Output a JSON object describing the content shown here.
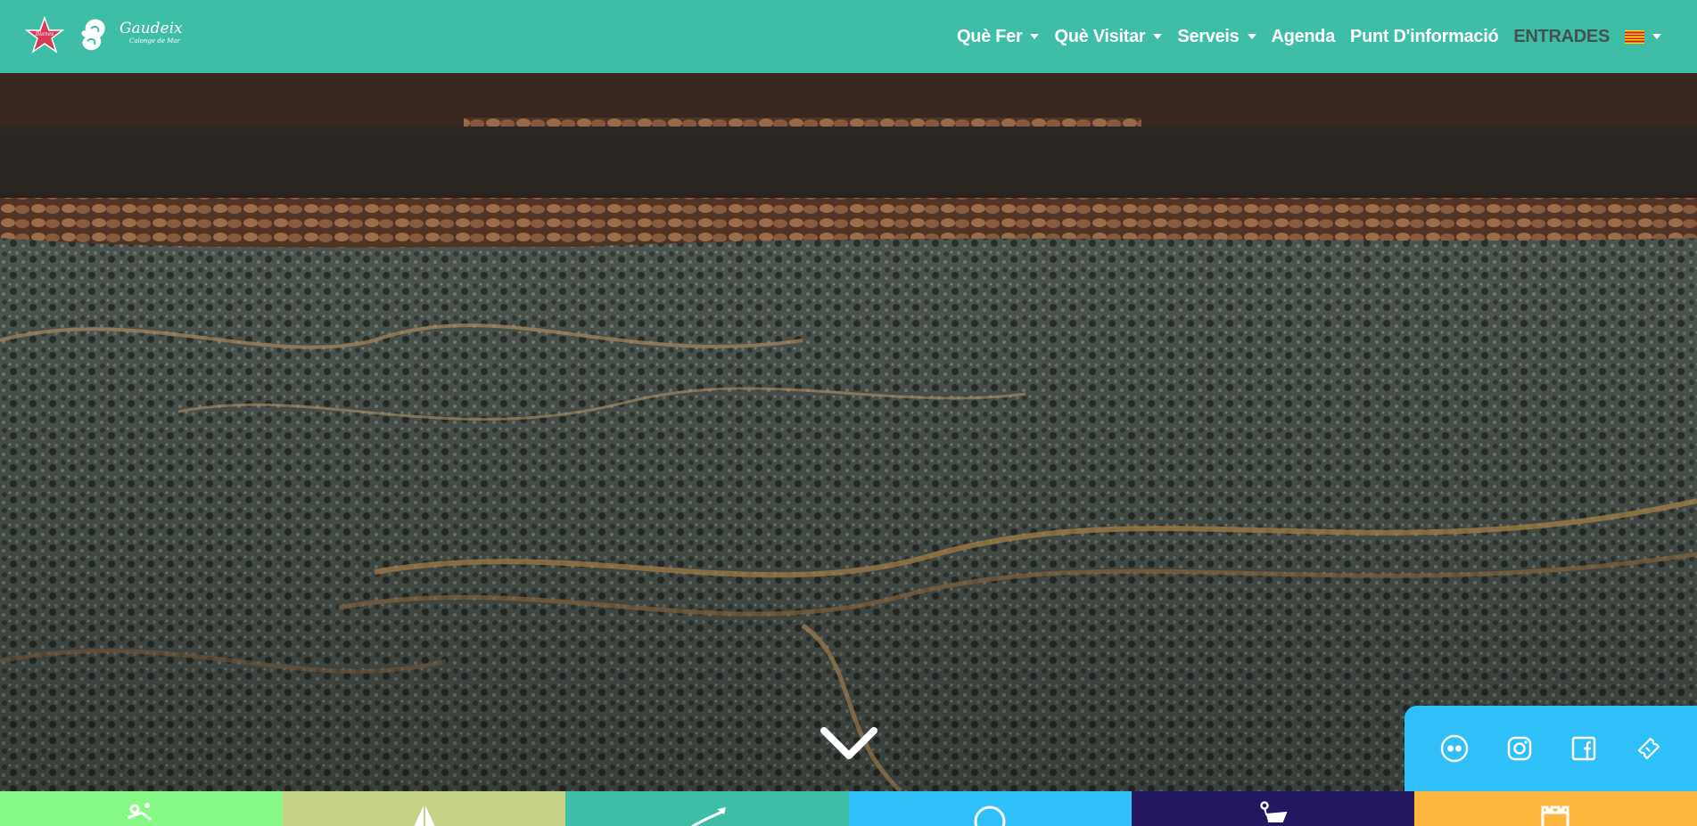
{
  "header": {
    "logo_star_text": "Blanes",
    "logo_name": "Gaudeix",
    "logo_subtitle": "Calonge de Mar",
    "nav": [
      {
        "label": "Què Fer",
        "has_dropdown": true
      },
      {
        "label": "Què Visitar",
        "has_dropdown": true
      },
      {
        "label": "Serveis",
        "has_dropdown": true
      },
      {
        "label": "Agenda",
        "has_dropdown": false
      },
      {
        "label": "Punt D'informació",
        "has_dropdown": false
      },
      {
        "label": "ENTRADES",
        "has_dropdown": false
      }
    ],
    "language_flag": "catalan-flag-icon"
  },
  "hero": {
    "image": "aerial-view-of-waves-breaking-on-rocky-coast",
    "scroll_icon": "chevron-down-icon"
  },
  "social": {
    "icons": [
      "flickr-icon",
      "instagram-icon",
      "facebook-icon",
      "ticket-icon"
    ]
  },
  "categories": [
    {
      "color": "#86f986",
      "icon": "cycling-icon"
    },
    {
      "color": "#c6d386",
      "icon": "sailboat-icon"
    },
    {
      "color": "#3ebda7",
      "icon": "kayak-icon"
    },
    {
      "color": "#2fbff9",
      "icon": "compass-icon"
    },
    {
      "color": "#221760",
      "icon": "shopping-cart-icon"
    },
    {
      "color": "#fdb73f",
      "icon": "castle-icon"
    }
  ],
  "colors": {
    "header": "#3ebda7",
    "social_panel": "#2fbff9",
    "entrades_text": "#45524f"
  }
}
